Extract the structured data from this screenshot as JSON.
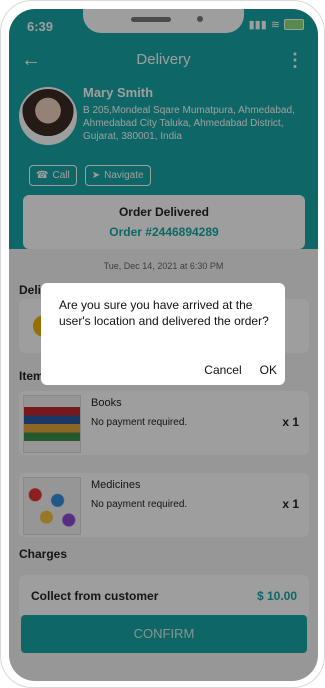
{
  "status": {
    "time": "6:39"
  },
  "header": {
    "title": "Delivery",
    "back_icon": "back-arrow-icon",
    "more_icon": "more-vertical-icon"
  },
  "customer": {
    "name": "Mary Smith",
    "address": "B 205,Mondeal Sqare Mumatpura, Ahmedabad, Ahmedabad City Taluka, Ahmedabad District, Gujarat, 380001, India",
    "call_label": "Call",
    "navigate_label": "Navigate"
  },
  "order": {
    "status": "Order Delivered",
    "id": "Order #2446894289"
  },
  "date": "Tue, Dec 14, 2021 at 6:30 PM",
  "sections": {
    "delivery": "Deli",
    "items": "Item",
    "charges": "Charges"
  },
  "items": [
    {
      "name": "Books",
      "payment": "No payment required.",
      "qty": "x 1"
    },
    {
      "name": "Medicines",
      "payment": "No payment required.",
      "qty": "x 1"
    }
  ],
  "charges": {
    "collect_label": "Collect from customer",
    "amount": "$ 10.00"
  },
  "confirm_label": "CONFIRM",
  "dialog": {
    "message": "Are you sure you have arrived at the user's location and delivered the order?",
    "cancel": "Cancel",
    "ok": "OK"
  },
  "colors": {
    "accent": "#17a7a5"
  }
}
